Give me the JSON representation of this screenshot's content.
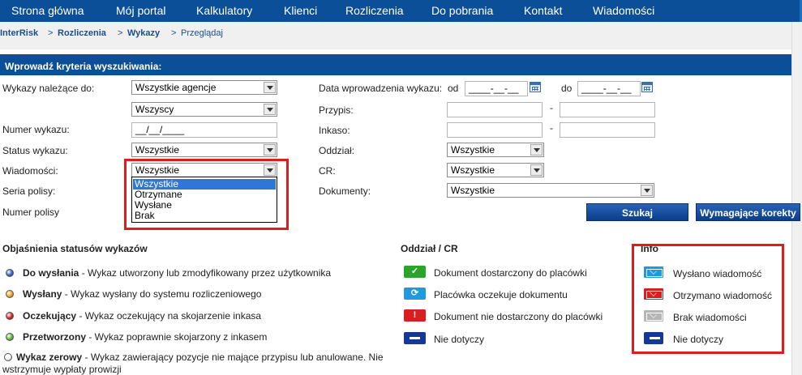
{
  "nav": {
    "items": [
      "Strona główna",
      "Mój portal",
      "Kalkulatory",
      "Klienci",
      "Rozliczenia",
      "Do pobrania",
      "Kontakt",
      "Wiadomości"
    ]
  },
  "breadcrumb": {
    "interrisk": "InterRisk",
    "sep": ">",
    "rozliczenia": "Rozliczenia",
    "wykazy": "Wykazy",
    "przegladaj": "Przeglądaj"
  },
  "form": {
    "header": "Wprowadź kryteria wyszukiwania:",
    "wykazy_label": "Wykazy należące do:",
    "agencje_value": "Wszystkie agencje",
    "wszyscy_value": "Wszyscy",
    "numer_label": "Numer wykazu:",
    "numer_value": "__/__/____",
    "status_label": "Status wykazu:",
    "status_value": "Wszystkie",
    "wiadomosci_label": "Wiadomości:",
    "wiadomosci_value": "Wszystkie",
    "wiadomosci_options": [
      "Wszystkie",
      "Otrzymane",
      "Wysłane",
      "Brak"
    ],
    "seria_label": "Seria polisy:",
    "numer_polisy_label": "Numer polisy",
    "data_label": "Data wprowadzenia wykazu:",
    "od_label": "od",
    "do_label": "do",
    "date_placeholder": "____-__-__",
    "przypis_label": "Przypis:",
    "inkaso_label": "Inkaso:",
    "range_dash": "-",
    "oddzial_label": "Oddział:",
    "oddzial_value": "Wszystkie",
    "cr_label": "CR:",
    "cr_value": "Wszystkie",
    "dokumenty_label": "Dokumenty:",
    "dokumenty_value": "Wszystkie",
    "szukaj_button": "Szukaj",
    "korekty_button": "Wymagające korekty"
  },
  "legend": {
    "status_title": "Objaśnienia statusów wykazów",
    "statuses": [
      {
        "name": "Do wysłania",
        "desc": " - Wykaz utworzony lub zmodyfikowany przez użytkownika",
        "color": "#2f5fc4"
      },
      {
        "name": "Wysłany",
        "desc": " - Wykaz wysłany do systemu rozliczeniowego",
        "color": "#f0a020"
      },
      {
        "name": "Oczekujący",
        "desc": " - Wykaz oczekujący na skojarzenie inkasa",
        "color": "#d02020"
      },
      {
        "name": "Przetworzony",
        "desc": " - Wykaz poprawnie skojarzony z inkasem",
        "color": "#5cb82a"
      },
      {
        "name": "Wykaz zerowy",
        "desc": " - Wykaz zawierający pozycje nie mające przypisu lub anulowane. Nie",
        "desc2": "wstrzymuje wypłaty prowizji",
        "color": "#f4f4f4"
      }
    ],
    "oddzial_title": "Oddział / CR",
    "oddzial_items": [
      {
        "label": "Dokument dostarczony do placówki",
        "icon": "check-icon",
        "color": "#2aa52a",
        "glyph": "✓"
      },
      {
        "label": "Placówka oczekuje dokumentu",
        "icon": "sync-icon",
        "color": "#1f9ae0",
        "glyph": "⟳"
      },
      {
        "label": "Dokument nie dostarczony do placówki",
        "icon": "exclamation-icon",
        "color": "#d81e1e",
        "glyph": "!"
      },
      {
        "label": "Nie dotyczy",
        "icon": "minus-icon",
        "color": "#12389a",
        "glyph": ""
      }
    ],
    "info_title": "Info",
    "info_items": [
      {
        "label": "Wysłano wiadomość",
        "icon": "envelope-sent-icon",
        "color": "#1f9ae0"
      },
      {
        "label": "Otrzymano wiadomość",
        "icon": "envelope-received-icon",
        "color": "#d81e1e"
      },
      {
        "label": "Brak wiadomości",
        "icon": "envelope-none-icon",
        "color": "#b5b5b5"
      },
      {
        "label": "Nie dotyczy",
        "icon": "minus-icon",
        "color": "#12389a"
      }
    ]
  }
}
